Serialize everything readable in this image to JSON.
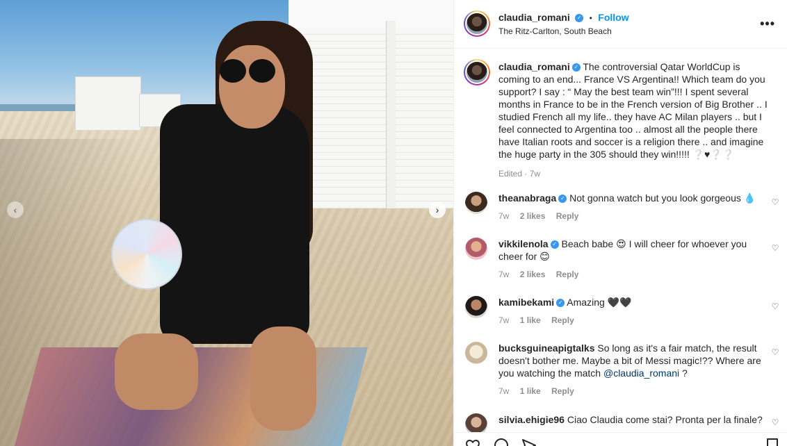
{
  "post": {
    "username": "claudia_romani",
    "follow_label": "Follow",
    "separator": "•",
    "location": "The Ritz-Carlton, South Beach",
    "more_label": "•••"
  },
  "caption": {
    "username": "claudia_romani",
    "text": "The controversial Qatar WorldCup is coming to an end... France VS Argentina!! Which team do you support? I say : “ May the best team win”!!! I spent several months in France to be in the French version of Big Brother .. I studied French all my life.. they have AC Milan players .. but I feel connected to Argentina too .. almost all the people there have Italian roots and soccer is a religion there .. and imagine the huge party in the 305 should they win!!!!! ❔♥❔❔",
    "meta": "Edited · 7w"
  },
  "comments": [
    {
      "username": "theanabraga",
      "text": "Not gonna watch but you look gorgeous 💧",
      "age": "7w",
      "likes": "2 likes",
      "reply": "Reply",
      "verified": true
    },
    {
      "username": "vikkilenola",
      "text": "Beach babe 😍 I will cheer for whoever you cheer for 😊",
      "age": "7w",
      "likes": "2 likes",
      "reply": "Reply",
      "verified": true
    },
    {
      "username": "kamibekami",
      "text": "Amazing 🖤🖤",
      "age": "7w",
      "likes": "1 like",
      "reply": "Reply",
      "verified": true
    },
    {
      "username": "bucksguineapigtalks",
      "text": "So long as it's a fair match, the result doesn't bother me. Maybe a bit of Messi magic!?? Where are you watching the match",
      "mention": "@claudia_romani",
      "suffix": " ?",
      "age": "7w",
      "likes": "1 like",
      "reply": "Reply",
      "verified": false
    },
    {
      "username": "silvia.ehigie96",
      "text": "Ciao Claudia come stai? Pronta per la finale?",
      "verified": false
    }
  ],
  "icons": {
    "prev": "‹",
    "next": "›",
    "heart": "♡",
    "verified": "✓"
  },
  "colors": {
    "accent": "#0095f6",
    "verified": "#3897f0",
    "muted": "#8e8e8e"
  }
}
